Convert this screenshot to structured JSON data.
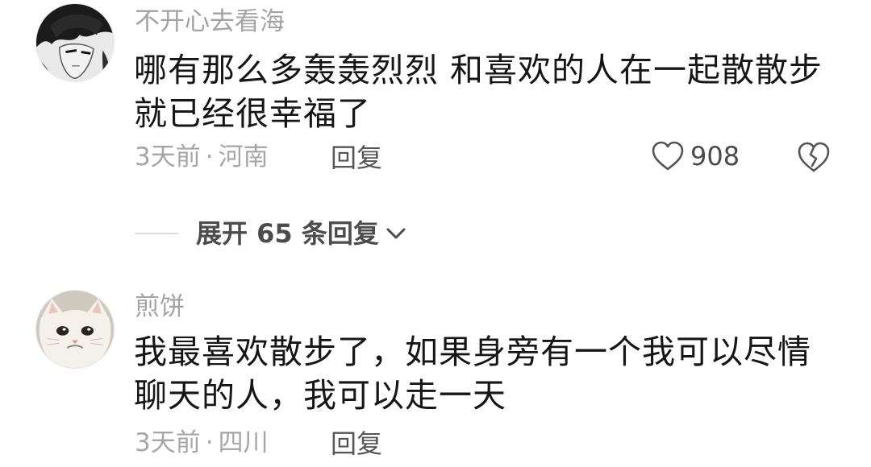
{
  "comments": [
    {
      "username": "不开心去看海",
      "text_line1": "哪有那么多轰轰烈烈 和喜欢的人在一起散散步",
      "text_line2": "就已经很幸福了",
      "time": "3天前",
      "separator": "·",
      "location": "河南",
      "reply_label": "回复",
      "like_count": "908",
      "avatar_icon": "anime-character-avatar",
      "like_icon": "heart-outline-icon",
      "dislike_icon": "broken-heart-icon"
    },
    {
      "username": "煎饼",
      "text_line1": "我最喜欢散步了，如果身旁有一个我可以尽情",
      "text_line2": "聊天的人，我可以走一天",
      "time": "3天前",
      "separator": "·",
      "location": "四川",
      "reply_label": "回复",
      "avatar_icon": "cat-avatar"
    }
  ],
  "expand_replies": {
    "label": "展开 65 条回复",
    "icon": "chevron-down-icon"
  },
  "colors": {
    "username": "#a3a3a3",
    "content": "#161616",
    "meta": "#a6a6a6",
    "reply": "#555555"
  }
}
